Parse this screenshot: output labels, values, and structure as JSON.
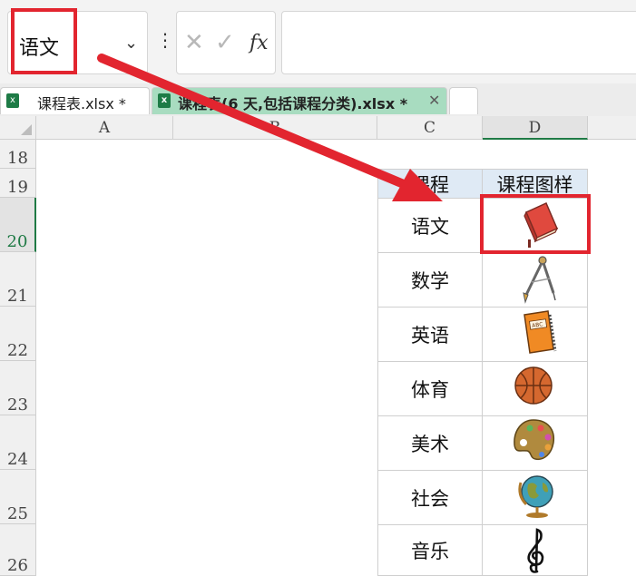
{
  "name_box": {
    "value": "语文"
  },
  "formula_icons": [
    "cancel-icon",
    "confirm-icon",
    "fx-icon"
  ],
  "fx_label": "fx",
  "tabs": [
    {
      "label": "课程表.xlsx *"
    },
    {
      "label": "课程表(6 天,包括课程分类).xlsx *"
    }
  ],
  "columns": [
    "A",
    "B",
    "C",
    "D"
  ],
  "rows": [
    "18",
    "19",
    "20",
    "21",
    "22",
    "23",
    "24",
    "25",
    "26"
  ],
  "table": {
    "headers": [
      "课程",
      "课程图样"
    ],
    "subjects": [
      {
        "name": "语文",
        "icon": "book-icon"
      },
      {
        "name": "数学",
        "icon": "compass-icon"
      },
      {
        "name": "英语",
        "icon": "notebook-icon"
      },
      {
        "name": "体育",
        "icon": "basketball-icon"
      },
      {
        "name": "美术",
        "icon": "palette-icon"
      },
      {
        "name": "社会",
        "icon": "globe-icon"
      },
      {
        "name": "音乐",
        "icon": "treble-clef-icon"
      }
    ]
  },
  "colors": {
    "annotation_red": "#e2252f",
    "active_tab": "#a8dcc0",
    "header_fill": "#dfeaf5",
    "excel_green": "#1f7a45"
  }
}
